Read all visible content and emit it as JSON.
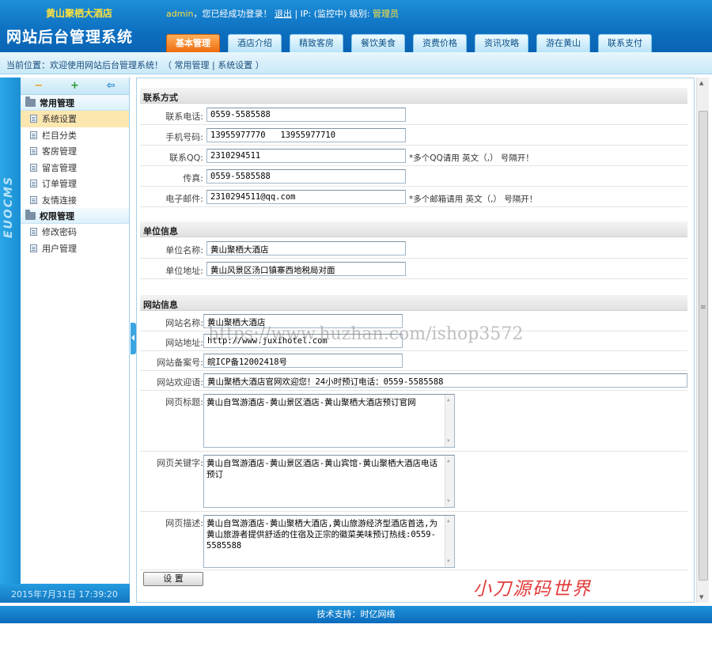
{
  "header": {
    "site_name": "黄山聚栖大酒店",
    "user": "admin",
    "login_msg": "，您已经成功登录！",
    "logout": "退出",
    "ip_label": " | IP: (监控中)  级别: ",
    "level": "管理员",
    "system_title": "网站后台管理系统"
  },
  "nav": {
    "tabs": [
      "基本管理",
      "酒店介绍",
      "精致客房",
      "餐饮美食",
      "资费价格",
      "资讯攻略",
      "游在黄山",
      "联系支付"
    ]
  },
  "breadcrumb": {
    "text": "当前位置：欢迎使用网站后台管理系统！（ 常用管理 | 系统设置 ）"
  },
  "sidebar": {
    "logo": "EUOCMS",
    "tools": [
      "−",
      "+",
      "⇦"
    ],
    "groups": [
      {
        "title": "常用管理",
        "items": [
          "系统设置",
          "栏目分类",
          "客房管理",
          "留言管理",
          "订单管理",
          "友情连接"
        ]
      },
      {
        "title": "权限管理",
        "items": [
          "修改密码",
          "用户管理"
        ]
      }
    ],
    "datetime": "2015年7月31日 17:39:20"
  },
  "contact": {
    "title": "联系方式",
    "phone": {
      "label": "联系电话:",
      "value": "0559-5585588"
    },
    "mobile": {
      "label": "手机号码:",
      "value": "13955977770   13955977710"
    },
    "qq": {
      "label": "联系QQ:",
      "value": "2310294511",
      "hint": "*多个QQ请用 英文（,） 号隔开！"
    },
    "fax": {
      "label": "传真:",
      "value": "0559-5585588"
    },
    "email": {
      "label": "电子邮件:",
      "value": "2310294511@qq.com",
      "hint": "*多个邮箱请用 英文（,） 号隔开！"
    }
  },
  "unit": {
    "title": "单位信息",
    "name": {
      "label": "单位名称:",
      "value": "黄山聚栖大酒店"
    },
    "address": {
      "label": "单位地址:",
      "value": "黄山风景区汤口镇寨西地税局对面"
    }
  },
  "website": {
    "title": "网站信息",
    "site_name": {
      "label": "网站名称:",
      "value": "黄山聚栖大酒店"
    },
    "site_url": {
      "label": "网站地址:",
      "value": "http://www.juxihotel.com"
    },
    "icp": {
      "label": "网站备案号:",
      "value": "皖ICP备12002418号"
    },
    "welcome": {
      "label": "网站欢迎语:",
      "value": "黄山聚栖大酒店官网欢迎您！24小时预订电话：0559-5585588"
    },
    "page_title": {
      "label": "网页标题:",
      "value": "黄山自驾游酒店-黄山景区酒店-黄山聚栖大酒店预订官网"
    },
    "keywords": {
      "label": "网页关键字:",
      "value": "黄山自驾游酒店-黄山景区酒店-黄山宾馆-黄山聚栖大酒店电话预订"
    },
    "description": {
      "label": "网页描述:",
      "value": "黄山自驾游酒店-黄山聚栖大酒店,黄山旅游经济型酒店首选,为黄山旅游者提供舒适的住宿及正宗的徽菜美味预订热线:0559-5585588"
    }
  },
  "submit_label": "设 置",
  "watermark": "小刀源码世界",
  "overlay_url": "https://www.huzhan.com/ishop3572",
  "footer": "技术支持：时亿网络",
  "colors": {
    "header_blue": "#0d6fc0",
    "active_tab": "#ee6b0e",
    "site_name_yellow": "#ffe23d",
    "watermark_red": "#e23b3b"
  }
}
